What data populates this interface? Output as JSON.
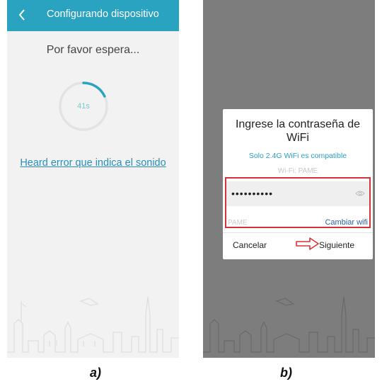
{
  "panel_a": {
    "header": {
      "title": "Configurando dispositivo",
      "back_icon": "chevron-left-icon"
    },
    "wait_text": "Por favor espera...",
    "timer": {
      "text": "41s",
      "progress_fraction": 0.18
    },
    "error_link": "Heard error que indica el sonido"
  },
  "panel_b": {
    "dialog": {
      "title_line1": "Ingrese la contraseña de",
      "title_line2": "WiFi",
      "compat_note": "Solo 2.4G WiFi es compatible",
      "ssid_label": "Wi-Fi: PAME",
      "password_value": "••••••••••",
      "eye_icon": "eye-icon",
      "ssid_small": "PAME",
      "change_wifi": "Cambiar wifi",
      "cancel": "Cancelar",
      "next": "Siguiente",
      "highlight_color": "#d6323a"
    }
  },
  "captions": {
    "a": "a)",
    "b": "b)"
  },
  "colors": {
    "accent": "#29a3c0",
    "link": "#2a8fb8"
  }
}
